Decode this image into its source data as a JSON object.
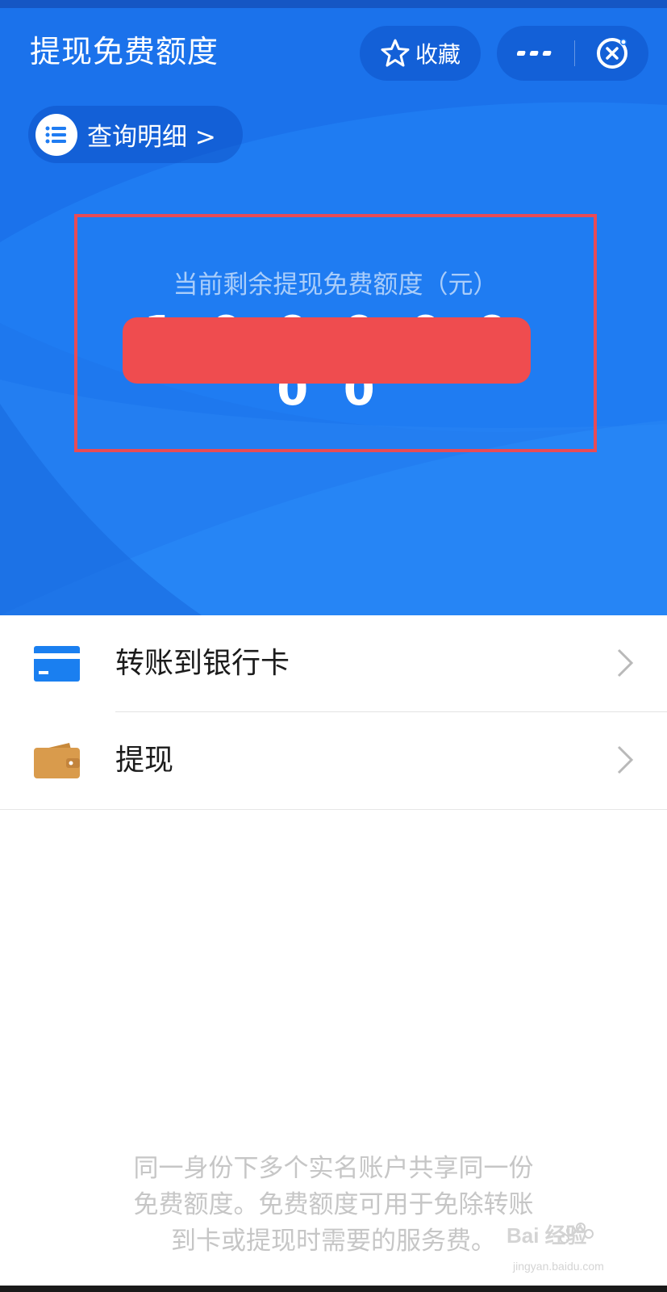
{
  "header": {
    "title": "提现免费额度",
    "favorite_label": "收藏",
    "more_icon": "more-dots-icon",
    "close_icon": "close-circle-icon"
  },
  "detail": {
    "label": "查询明细 >",
    "icon": "list-icon"
  },
  "balance": {
    "label": "当前剩余提现免费额度（元）",
    "amount": "1 0 0 0 0 0 0 0"
  },
  "menu": {
    "items": [
      {
        "label": "转账到银行卡",
        "icon": "bank-card-icon"
      },
      {
        "label": "提现",
        "icon": "wallet-icon"
      }
    ]
  },
  "footnote": {
    "line1": "同一身份下多个实名账户共享同一份",
    "line2": "免费额度。免费额度可用于免除转账",
    "line3": "到卡或提现时需要的服务费。"
  },
  "watermark": {
    "text": "Bai 经验",
    "sub": "jingyan.baidu.com"
  },
  "colors": {
    "primary": "#1f7cf2",
    "highlight": "#e84b56",
    "redaction": "#ef4c4f"
  }
}
